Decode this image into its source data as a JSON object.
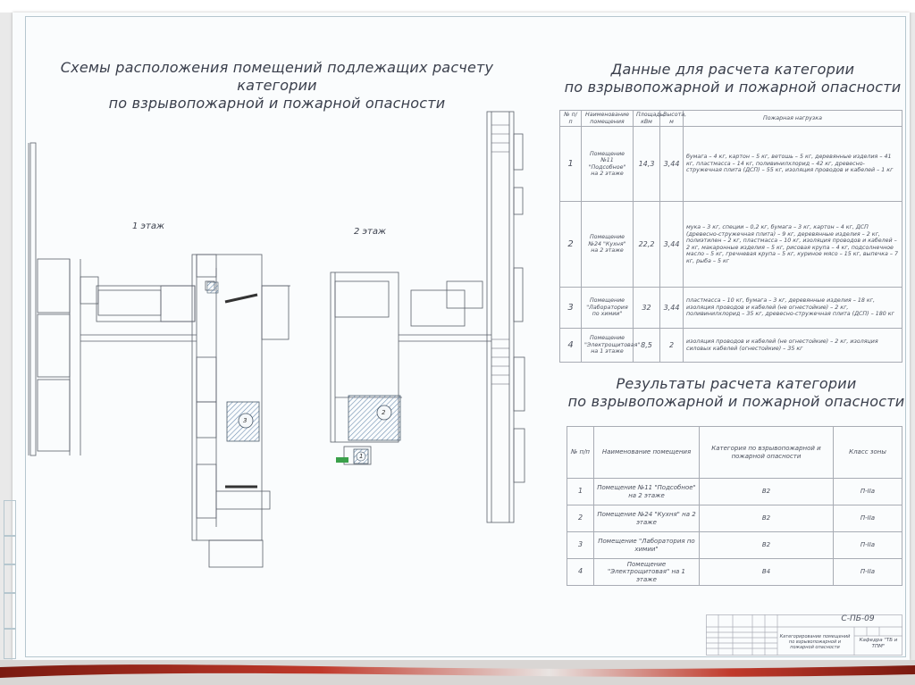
{
  "plans": {
    "title_line1": "Схемы расположения помещений подлежащих расчету категории",
    "title_line2": "по взрывопожарной и пожарной опасности",
    "floor1_label": "1 этаж",
    "floor2_label": "2 этаж",
    "room_markers": [
      "3",
      "2",
      "1",
      "1",
      "4"
    ]
  },
  "data_section": {
    "title_line1": "Данные для расчета категории",
    "title_line2": "по взрывопожарной и пожарной опасности",
    "headers": {
      "num": "№ п/п",
      "name": "Наименование помещения",
      "area": "Площадь, кВм",
      "height": "Высота, м",
      "load": "Пожарная нагрузка"
    },
    "rows": [
      {
        "num": "1",
        "name": "Помещение №11 \"Подсобное\" на 2 этаже",
        "area": "14,3",
        "height": "3,44",
        "load": "бумага – 4 кг, картон – 5 кг, ветошь – 5 кг, деревянные изделия – 41 кг, пластмасса – 14 кг, поливинилхлорид – 42 кг, древесно-стружечная плита (ДСП) – 55 кг, изоляция проводов и кабелей – 1 кг"
      },
      {
        "num": "2",
        "name": "Помещение №24 \"Кухня\" на 2 этаже",
        "area": "22,2",
        "height": "3,44",
        "load": "мука – 3 кг, специи – 0,2 кг, бумага – 3 кг, картон – 4 кг, ДСП (древесно-стружечная плита) – 9 кг, деревянные изделия – 2 кг, полиэтилен – 2 кг, пластмасса – 10 кг, изоляция проводов и кабелей – 2 кг, макаронные изделия – 5 кг, рисовая крупа – 4 кг, подсолнечное масло – 5 кг, гречневая крупа – 5 кг, куриное мясо – 15 кг, выпечка – 7 кг, рыба – 5 кг"
      },
      {
        "num": "3",
        "name": "Помещение \"Лаборатория по химии\"",
        "area": "32",
        "height": "3,44",
        "load": "пластмасса – 10 кг, бумага – 3 кг, деревянные изделия – 18 кг, изоляция проводов и кабелей (не огнестойкие) – 2 кг, поливинилхлорид – 35 кг, древесно-стружечная плита (ДСП) – 180 кг"
      },
      {
        "num": "4",
        "name": "Помещение \"Электрощитовая\" на 1 этаже",
        "area": "8,5",
        "height": "2",
        "load": "изоляция проводов и кабелей (не огнестойкие) – 2 кг, изоляция силовых кабелей (огнестойкие) – 35 кг"
      }
    ]
  },
  "results_section": {
    "title_line1": "Результаты расчета категории",
    "title_line2": "по взрывопожарной и пожарной опасности",
    "headers": {
      "num": "№ п/п",
      "name": "Наименование помещения",
      "category": "Категория по взрывопожарной и пожарной опасности",
      "zone": "Класс зоны"
    },
    "rows": [
      {
        "num": "1",
        "name": "Помещение №11 \"Подсобное\" на 2 этаже",
        "category": "В2",
        "zone": "П-IIа"
      },
      {
        "num": "2",
        "name": "Помещение №24 \"Кухня\" на 2 этаже",
        "category": "В2",
        "zone": "П-IIа"
      },
      {
        "num": "3",
        "name": "Помещение \"Лаборатория по химии\"",
        "category": "В2",
        "zone": "П-IIа"
      },
      {
        "num": "4",
        "name": "Помещение \"Электрощитовая\" на 1 этаже",
        "category": "В4",
        "zone": "П-IIа"
      }
    ]
  },
  "stamp": {
    "code": "С-ПБ-09",
    "description": "Категорирование помещений по взрывопожарной и пожарной опасности",
    "department": "Кафедра \"ТБ и ТПМ\""
  },
  "colors": {
    "sheet": "#fafcfd",
    "frame": "#b6c7cf",
    "ink": "#2a2f3a",
    "hatch": "#6f8fb0",
    "band_red": "#c0392b"
  }
}
